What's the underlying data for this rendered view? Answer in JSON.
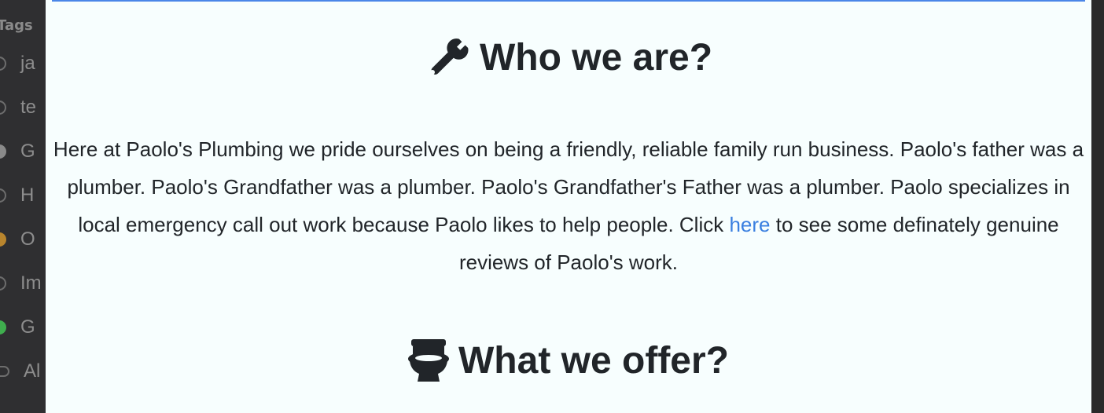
{
  "sidebar": {
    "heading": "Tags",
    "items": [
      {
        "label": "ja",
        "dot": "outline",
        "color": ""
      },
      {
        "label": "te",
        "dot": "outline",
        "color": ""
      },
      {
        "label": "G",
        "dot": "filled",
        "color": "#8a8a8a"
      },
      {
        "label": "H",
        "dot": "outline",
        "color": ""
      },
      {
        "label": "O",
        "dot": "filled",
        "color": "#b9852d"
      },
      {
        "label": "Im",
        "dot": "outline",
        "color": ""
      },
      {
        "label": "G",
        "dot": "filled",
        "color": "#3fae4e"
      },
      {
        "label": "Al",
        "dot": "toggle",
        "color": ""
      }
    ]
  },
  "page": {
    "accent_color": "#4a86e8",
    "who": {
      "icon": "wrench-icon",
      "title": "Who we are?"
    },
    "intro": {
      "text": "Here at Paolo's Plumbing we pride ourselves on being a friendly, reliable family run business. Paolo's father was a plumber. Paolo's Grandfather was a plumber. Paolo's Grandfather's Father was a plumber. Paolo specializes in local emergency call out work because Paolo likes to help people. Click ",
      "link": "here",
      "tail": " to see some definately genuine reviews of Paolo's work."
    },
    "what": {
      "icon": "toilet-icon",
      "title": "What we offer?"
    }
  }
}
